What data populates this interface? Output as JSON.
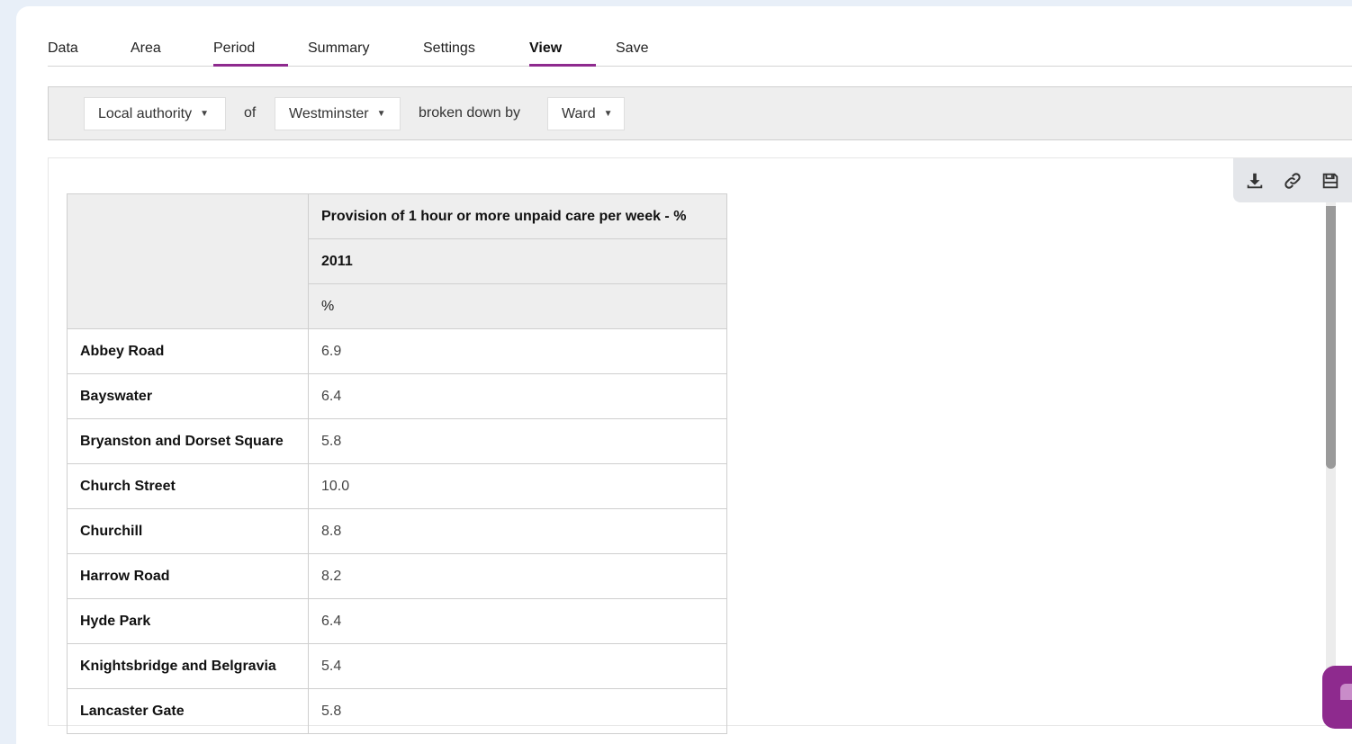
{
  "tabs": [
    {
      "label": "Data",
      "active": false
    },
    {
      "label": "Area",
      "active": false
    },
    {
      "label": "Period",
      "active": false,
      "underlined": true
    },
    {
      "label": "Summary",
      "active": false
    },
    {
      "label": "Settings",
      "active": false
    },
    {
      "label": "View",
      "active": true,
      "underlined": true
    },
    {
      "label": "Save",
      "active": false
    }
  ],
  "filters": {
    "area_type": "Local authority",
    "of_label": "of",
    "area": "Westminster",
    "breakdown_label": "broken down by",
    "breakdown": "Ward",
    "caret": "▼"
  },
  "toolbar": {
    "icons": [
      "download-icon",
      "link-icon",
      "save-icon"
    ]
  },
  "table": {
    "indicator": "Provision of 1 hour or more unpaid care per week - %",
    "period": "2011",
    "unit": "%",
    "rows": [
      {
        "area": "Abbey Road",
        "value": "6.9"
      },
      {
        "area": "Bayswater",
        "value": "6.4"
      },
      {
        "area": "Bryanston and Dorset Square",
        "value": "5.8"
      },
      {
        "area": "Church Street",
        "value": "10.0"
      },
      {
        "area": "Churchill",
        "value": "8.8"
      },
      {
        "area": "Harrow Road",
        "value": "8.2"
      },
      {
        "area": "Hyde Park",
        "value": "6.4"
      },
      {
        "area": "Knightsbridge and Belgravia",
        "value": "5.4"
      },
      {
        "area": "Lancaster Gate",
        "value": "5.8"
      }
    ]
  },
  "colors": {
    "accent": "#8e2a8e",
    "page_background": "#e8eff8",
    "header_background": "#eeeeee"
  }
}
